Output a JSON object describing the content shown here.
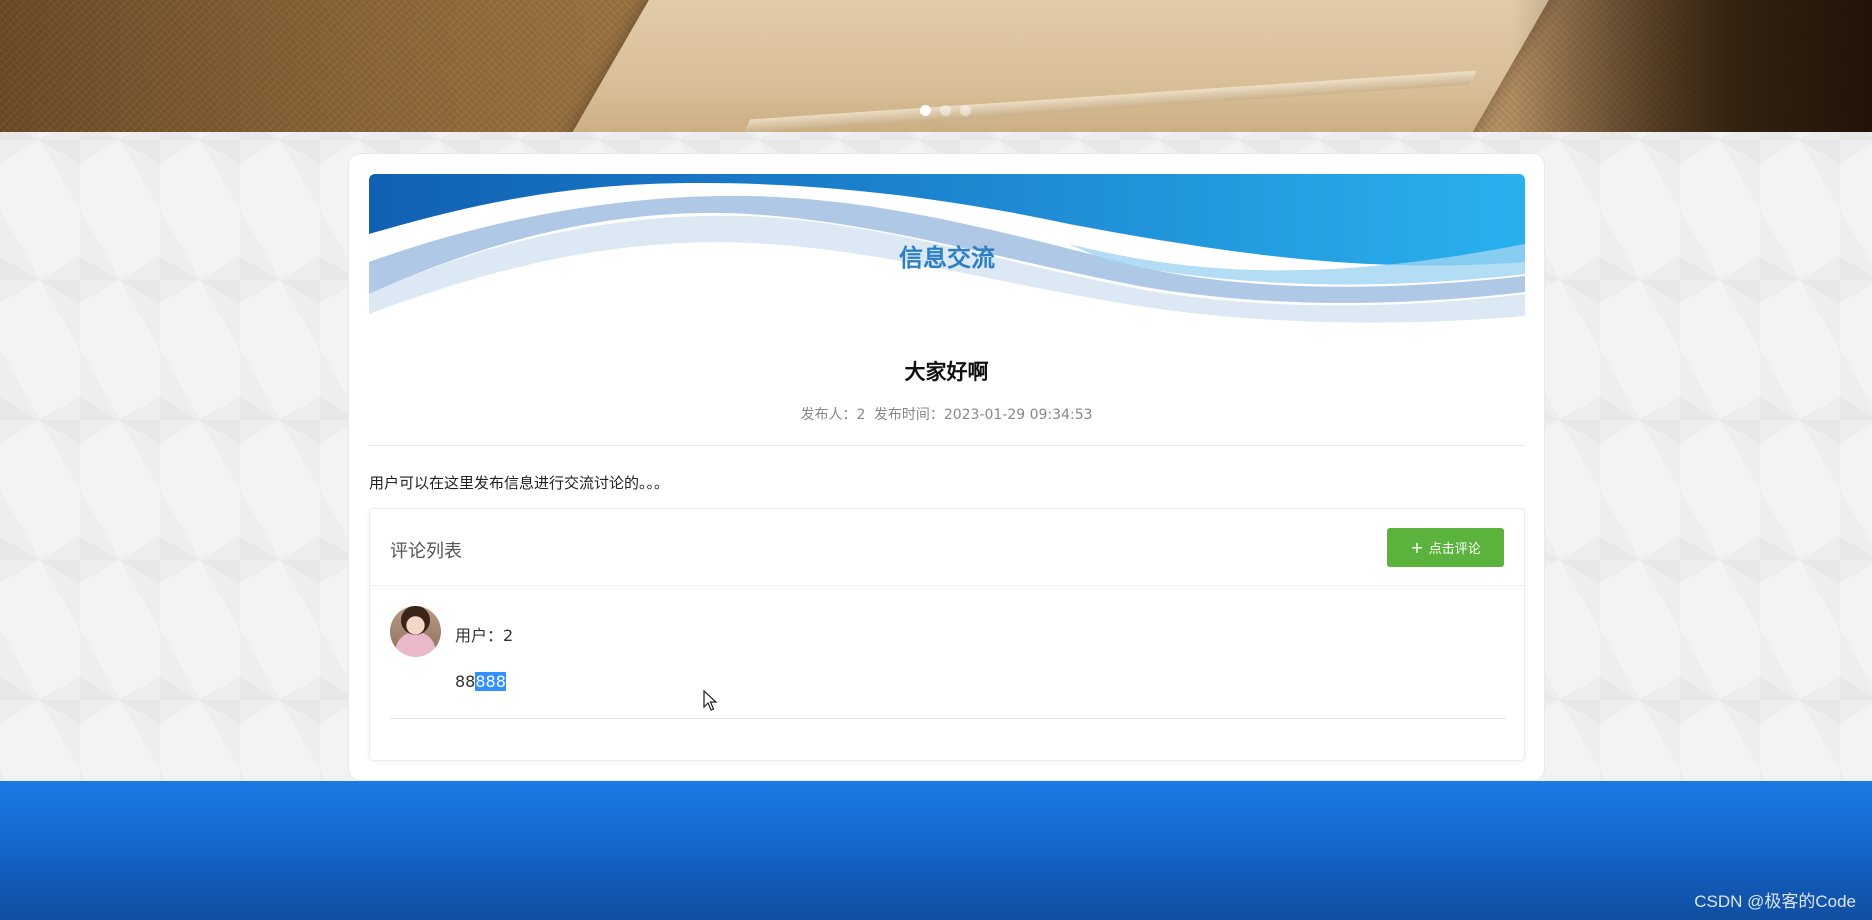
{
  "hero": {
    "slides_count": 3,
    "active_slide": 1
  },
  "banner": {
    "title": "信息交流"
  },
  "post": {
    "title": "大家好啊",
    "author_label": "发布人：2",
    "time_label": "发布时间：2023-01-29 09:34:53",
    "body": "用户可以在这里发布信息进行交流讨论的。。。"
  },
  "comments": {
    "title": "评论列表",
    "add_button_label": "点击评论",
    "items": [
      {
        "user": "用户：2",
        "content_plain": "88",
        "content_selected": "888"
      }
    ]
  },
  "colors": {
    "accent_blue": "#2a7fc6",
    "button_green": "#5bb23d",
    "footer_blue": "#1464c9"
  },
  "watermark": "CSDN @极客的Code"
}
